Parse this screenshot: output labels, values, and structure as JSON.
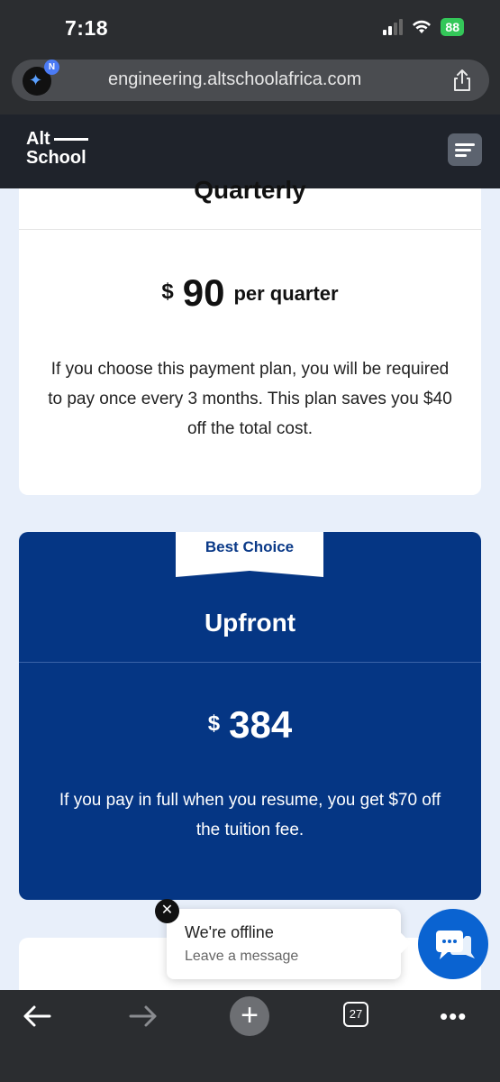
{
  "status_bar": {
    "time": "7:18",
    "battery": "88"
  },
  "browser": {
    "url": "engineering.altschoolafrica.com",
    "badge_letter": "N",
    "tab_count": "27"
  },
  "header": {
    "logo_line1": "Alt",
    "logo_line2": "School"
  },
  "quarterly_plan": {
    "title": "Quarterly",
    "currency": "$",
    "amount": "90",
    "period": "per quarter",
    "description": "If you choose this payment plan, you will be required to pay once every 3 months. This plan saves you $40 off the total cost."
  },
  "upfront_plan": {
    "badge": "Best Choice",
    "title": "Upfront",
    "currency": "$",
    "amount": "384",
    "description": "If you pay in full when you resume, you get $70 off the tuition fee."
  },
  "chat": {
    "title": "We're offline",
    "subtitle": "Leave a message"
  },
  "colors": {
    "brand_blue": "#053684",
    "header_dark": "#1f232b",
    "chat_blue": "#0a63d1",
    "page_bg": "#e8effa"
  }
}
